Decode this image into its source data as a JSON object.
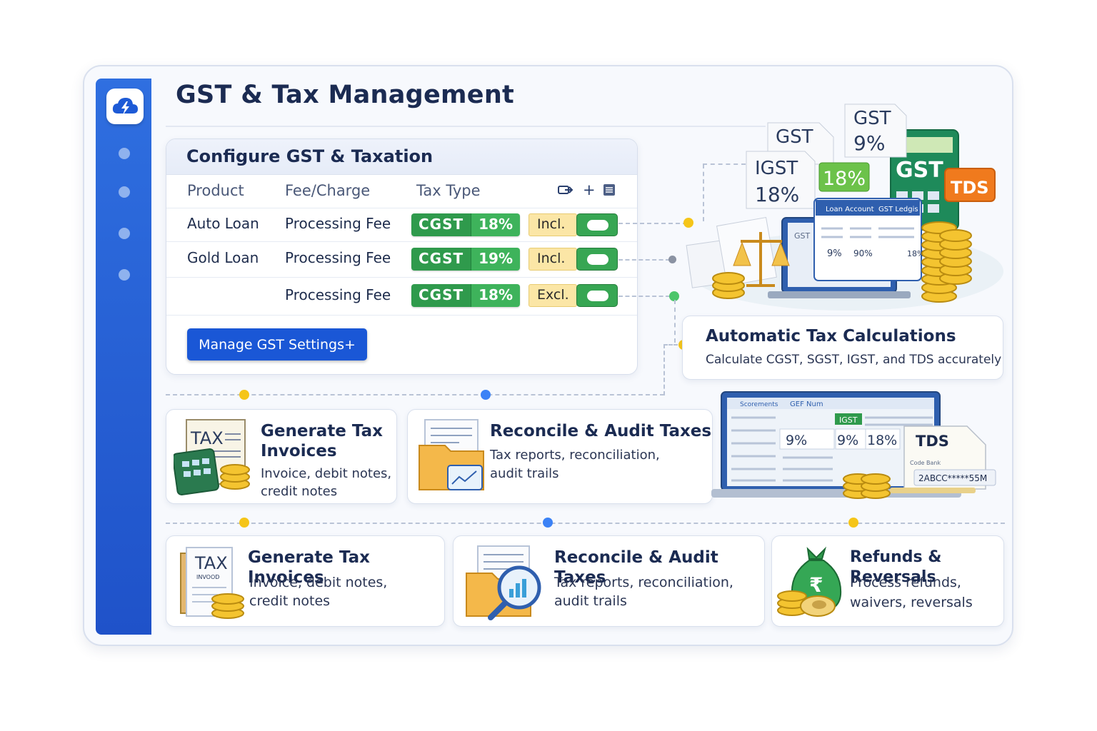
{
  "app": {
    "title": "GST & Tax Management"
  },
  "config": {
    "title": "Configure GST & Taxation",
    "columns": [
      "Product",
      "Fee/Charge",
      "Tax Type"
    ],
    "rows": [
      {
        "product": "Auto Loan",
        "fee": "Processing Fee",
        "tax": "CGST",
        "rate": "18%",
        "mode": "Incl.",
        "enabled": true
      },
      {
        "product": "Gold Loan",
        "fee": "Processing Fee",
        "tax": "CGST",
        "rate": "19%",
        "mode": "Incl.",
        "enabled": true
      },
      {
        "product": "",
        "fee": "Processing Fee",
        "tax": "CGST",
        "rate": "18%",
        "mode": "Excl.",
        "enabled": true
      }
    ],
    "manage_button": "Manage GST Settings+",
    "header_icons": [
      "export-icon",
      "add-icon",
      "list-icon"
    ],
    "header_add": "+"
  },
  "auto_calc": {
    "title": "Automatic Tax Calculations",
    "desc": "Calculate CGST, SGST, IGST, and TDS accurately"
  },
  "hero_labels": {
    "gst_top": "GST",
    "gst_top_rate": "9%",
    "gst_mid": "GST",
    "igst": "IGST",
    "igst_rate": "18%",
    "green_rate": "18%",
    "calc_label": "GST",
    "tds": "TDS",
    "loan_account": "Loan Account",
    "gst_ledger": "GST Ledgis",
    "ledger_gst": "GST",
    "ledger_values": [
      "9%",
      "90%",
      "18%"
    ]
  },
  "laptop_labels": {
    "tab1": "Scorements",
    "tab2": "GEF Num",
    "badge": "IGST",
    "values": [
      "9%",
      "9%",
      "18%"
    ],
    "tds": "TDS",
    "code_label": "Code Bank",
    "code": "2ABCC*****55M"
  },
  "cards_row1": [
    {
      "title_line1": "Generate Tax",
      "title_line2": "Invoices",
      "desc_line1": "Invoice, debit notes,",
      "desc_line2": "credit notes",
      "icon_label": "TAX"
    },
    {
      "title": "Reconcile & Audit Taxes",
      "desc_line1": "Tax reports, reconciliation,",
      "desc_line2": "audit trails"
    }
  ],
  "cards_row2": [
    {
      "title": "Generate Tax Invoices",
      "desc_line1": "Invoice, debit notes,",
      "desc_line2": "credit notes",
      "icon_label": "TAX",
      "icon_sub": "INVOOD"
    },
    {
      "title": "Reconcile & Audit Taxes",
      "desc_line1": "Tax reports, reconciliation,",
      "desc_line2": "audit trails"
    },
    {
      "title": "Refunds & Reversals",
      "desc_line1": "Process refunds,",
      "desc_line2": "waivers, reversals"
    }
  ],
  "colors": {
    "sidebar": "#2f6fe0",
    "primary_button": "#1a57d6",
    "tax_green": "#2f9a4c",
    "incl_yellow": "#fbe6a6",
    "tds_orange": "#f07a1d",
    "connector_yellow": "#f5c518",
    "connector_blue": "#3b82f6",
    "connector_green": "#4cc66a"
  }
}
